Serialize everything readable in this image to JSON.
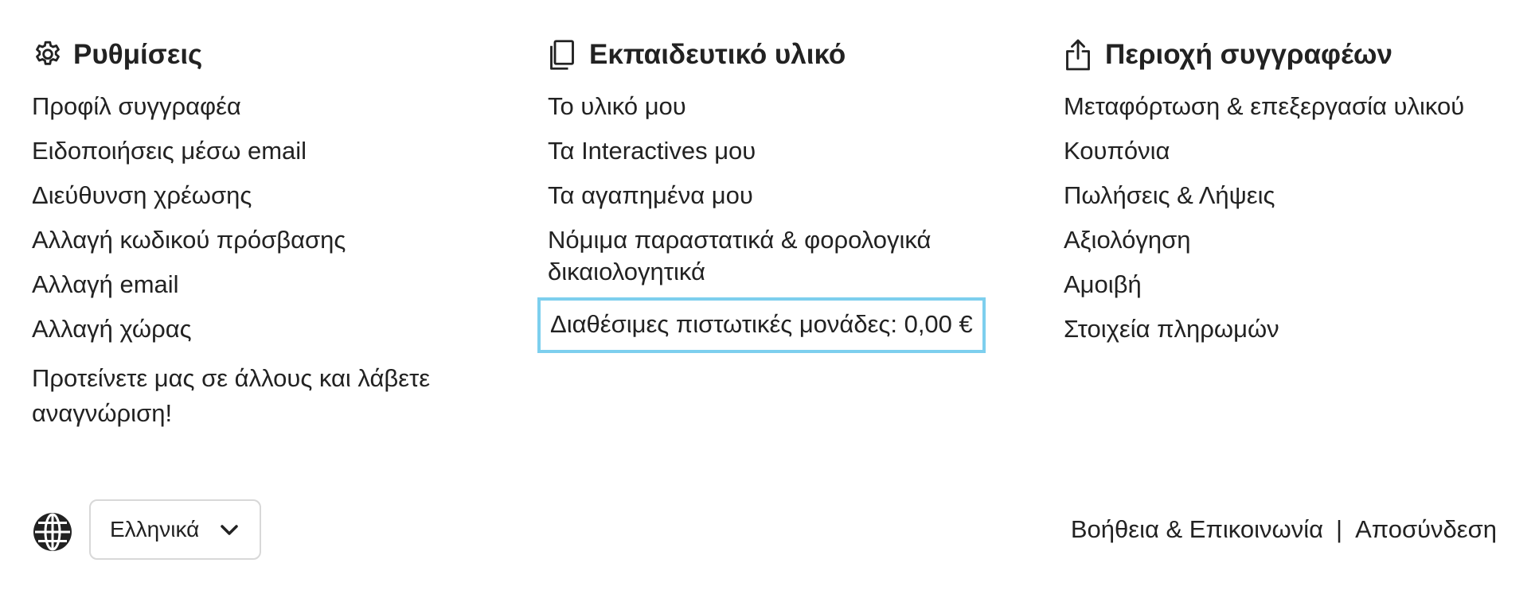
{
  "settings": {
    "title": "Ρυθμίσεις",
    "icon": "gear-icon",
    "links": [
      "Προφίλ συγγραφέα",
      "Ειδοποιήσεις μέσω email",
      "Διεύθυνση χρέωσης",
      "Αλλαγή κωδικού πρόσβασης",
      "Αλλαγή email",
      "Αλλαγή χώρας",
      "Προτείνετε μας σε άλλους και λάβετε αναγνώριση!"
    ]
  },
  "material": {
    "title": "Εκπαιδευτικό υλικό",
    "icon": "copy-icon",
    "links": [
      "Το υλικό μου",
      "Τα Interactives μου",
      "Τα αγαπημένα μου",
      "Νόμιμα παραστατικά & φορολογικά δικαιολογητικά"
    ],
    "credits_label": "Διαθέσιμες πιστωτικές μονάδες: 0,00 €",
    "credits_border_color": "#7dcfee"
  },
  "authors": {
    "title": "Περιοχή συγγραφέων",
    "icon": "upload-icon",
    "links": [
      "Μεταφόρτωση & επεξεργασία υλικού",
      "Κουπόνια",
      "Πωλήσεις & Λήψεις",
      "Αξιολόγηση",
      "Αμοιβή",
      "Στοιχεία πληρωμών"
    ]
  },
  "footer": {
    "language_icon": "globe-icon",
    "language_selected": "Ελληνικά",
    "help_label": "Βοήθεια & Επικοινωνία",
    "separator": "|",
    "logout_label": "Αποσύνδεση"
  }
}
